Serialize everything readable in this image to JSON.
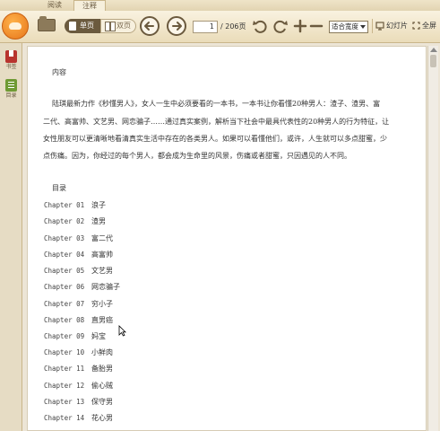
{
  "tabs": [
    {
      "label": "阅读",
      "active": false
    },
    {
      "label": "注释",
      "active": true
    }
  ],
  "toolbar": {
    "single_page_label": "单页",
    "double_page_label": "双页",
    "current_page": "1",
    "page_total": "/ 206页",
    "zoom_value": "适合宽度",
    "slideshow_label": "幻灯片",
    "fullscreen_label": "全屏"
  },
  "sidebar": {
    "items": [
      {
        "label": "书签",
        "icon": "bookmark-icon"
      },
      {
        "label": "目录",
        "icon": "toc-icon"
      }
    ]
  },
  "content": {
    "intro_heading": "内容",
    "summary_lines": [
      "陆琪最新力作《秒懂男人》，女人一生中必须要看的一本书，一本书让你看懂20种男人：渣子、渣男、富",
      "二代、高富帅、文艺男、网恋骗子……通过真实案例，解析当下社会中最具代表性的20种男人的行为特征，让",
      "女性朋友可以更清晰地看清真实生活中存在的各类男人。如果可以看懂他们，或许，人生就可以多点甜蜜，少",
      "点伤痛。因为，你经过的每个男人，都会成为生命里的风景，伤痛或者甜蜜，只因遇见的人不同。"
    ],
    "toc_heading": "目录",
    "chapters": [
      {
        "label": "Chapter 01",
        "title": "浪子"
      },
      {
        "label": "Chapter 02",
        "title": "渣男"
      },
      {
        "label": "Chapter 03",
        "title": "富二代"
      },
      {
        "label": "Chapter 04",
        "title": "高富帅"
      },
      {
        "label": "Chapter 05",
        "title": "文艺男"
      },
      {
        "label": "Chapter 06",
        "title": "网恋骗子"
      },
      {
        "label": "Chapter 07",
        "title": "穷小子"
      },
      {
        "label": "Chapter 08",
        "title": "直男癌"
      },
      {
        "label": "Chapter 09",
        "title": "妈宝"
      },
      {
        "label": "Chapter 10",
        "title": "小鲜肉"
      },
      {
        "label": "Chapter 11",
        "title": "备胎男"
      },
      {
        "label": "Chapter 12",
        "title": "偷心贼"
      },
      {
        "label": "Chapter 13",
        "title": "保守男"
      },
      {
        "label": "Chapter 14",
        "title": "花心男"
      }
    ]
  },
  "colors": {
    "toolbar_bg": "#eadcb9",
    "accent_dark": "#6b5a3e",
    "logo_orange": "#e6751a",
    "bookmark_red": "#b8342e",
    "toc_green": "#6f9a34"
  }
}
